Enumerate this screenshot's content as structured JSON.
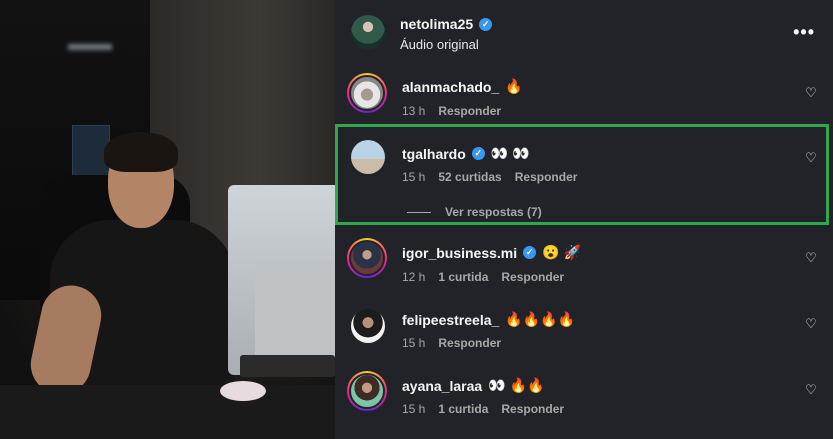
{
  "post": {
    "username": "netolima25",
    "audio": "Áudio original",
    "more_label": "•••"
  },
  "comments": [
    {
      "username": "alanmachado_",
      "verified": false,
      "text": "🔥",
      "time": "13 h",
      "likes": "",
      "reply": "Responder"
    },
    {
      "username": "tgalhardo",
      "verified": true,
      "text": "👀 👀",
      "time": "15 h",
      "likes": "52 curtidas",
      "reply": "Responder",
      "view_replies": "Ver respostas (7)"
    },
    {
      "username": "igor_business.mi",
      "verified": true,
      "text": "😮 🚀",
      "time": "12 h",
      "likes": "1 curtida",
      "reply": "Responder"
    },
    {
      "username": "felipeestreela_",
      "verified": false,
      "text": "🔥🔥🔥🔥",
      "time": "15 h",
      "likes": "",
      "reply": "Responder"
    },
    {
      "username": "ayana_laraa",
      "verified": false,
      "text": "👀 🔥🔥",
      "time": "15 h",
      "likes": "1 curtida",
      "reply": "Responder"
    }
  ],
  "icons": {
    "verified": "verified-badge-icon",
    "heart": "heart-outline-icon",
    "more": "more-horizontal-icon"
  },
  "colors": {
    "panel_bg": "#212328",
    "highlight": "#2ea84a",
    "verified": "#3897f0"
  }
}
